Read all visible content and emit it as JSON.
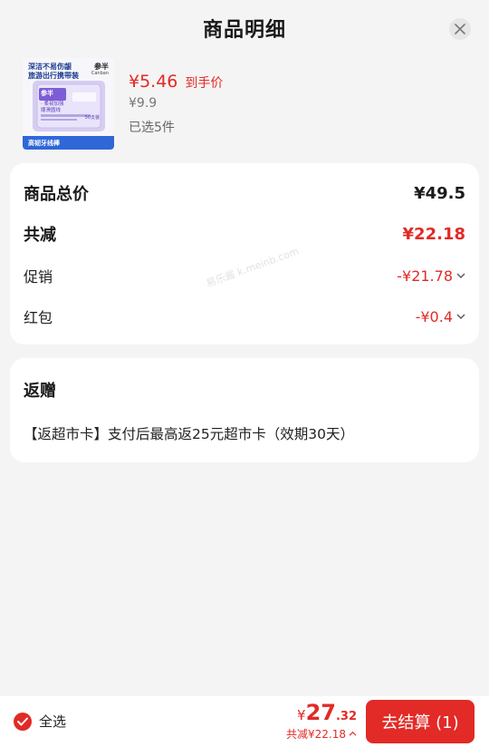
{
  "header": {
    "title": "商品明细"
  },
  "product": {
    "price": "¥5.46",
    "price_tag": "到手价",
    "original_price": "¥9.9",
    "selected_count": "已选5件",
    "thumb": {
      "line1": "深洁不易伤龈",
      "line2": "旅游出行携带装",
      "brand": "参半",
      "brand_en": "Canban",
      "pack_brand": "参半",
      "pack_line1": "· 柔韧加强",
      "pack_line2": "顺滑圆线",
      "pack_count": "50支装",
      "bottom_label": "高韧牙线棒"
    }
  },
  "summary": {
    "total_label": "商品总价",
    "total_value": "¥49.5",
    "reduce_label": "共减",
    "reduce_value": "¥22.18",
    "promo_label": "促销",
    "promo_value": "-¥21.78",
    "redpacket_label": "红包",
    "redpacket_value": "-¥0.4"
  },
  "gift": {
    "title": "返赠",
    "text": "【返超市卡】支付后最高返25元超市卡（效期30天）"
  },
  "watermark": "易乐酱 k.meinb.com",
  "footer": {
    "select_all": "全选",
    "total_symbol": "¥",
    "total_int": "27",
    "total_dec": ".32",
    "discount": "共减¥22.18",
    "checkout": "去结算 (1)"
  },
  "colors": {
    "accent": "#e22a26",
    "background": "#f4f4f4"
  },
  "icons": {
    "close": "close-icon",
    "chevron": "chevron-down-icon",
    "check": "check-icon",
    "chevron_up": "chevron-up-icon"
  }
}
